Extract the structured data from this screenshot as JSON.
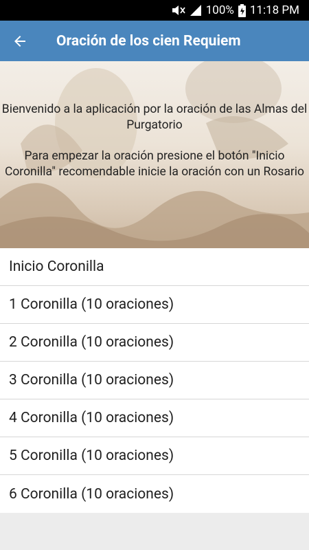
{
  "status_bar": {
    "battery_percent": "100%",
    "time": "11:18 PM",
    "icons": [
      "mute-icon",
      "signal-icon",
      "battery-charging-icon"
    ]
  },
  "app_bar": {
    "title": "Oración de los cien Requiem",
    "back_icon": "arrow-back-icon"
  },
  "banner": {
    "paragraph1": "Bienvenido a la aplicación por la oración de las Almas del Purgatorio",
    "paragraph2": "Para empezar la oración presione el botón \"Inicio Coronilla\" recomendable inicie la oración con un Rosario"
  },
  "list": {
    "items": [
      "Inicio Coronilla",
      "1 Coronilla (10 oraciones)",
      "2 Coronilla (10 oraciones)",
      "3 Coronilla (10 oraciones)",
      "4 Coronilla (10 oraciones)",
      "5 Coronilla (10 oraciones)",
      "6 Coronilla (10 oraciones)"
    ]
  },
  "colors": {
    "app_bar": "#4a86bd",
    "status_bar": "#000000",
    "background": "#ececec"
  }
}
